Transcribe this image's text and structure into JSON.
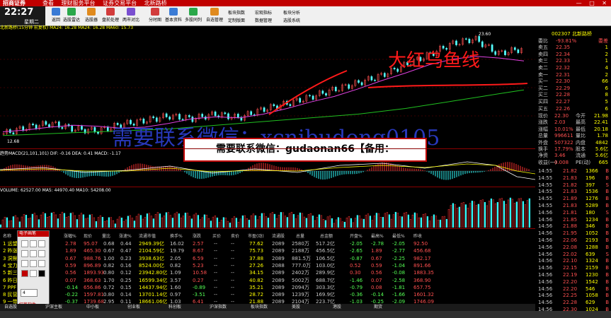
{
  "titlebar": {
    "logo": "招商证券",
    "menu": [
      "查看",
      "理财服务平台",
      "证券交易平台",
      "北新路桥"
    ],
    "win_buttons": [
      "—",
      "□",
      "✕"
    ]
  },
  "clock": {
    "time": "22:27",
    "day": "星期二"
  },
  "toolbar": {
    "items": [
      "返回",
      "选股雷达",
      "选股器",
      "盘前处理",
      "两市对比",
      "分时图",
      "基本资料",
      "多股同列",
      "自选管理"
    ],
    "menu": [
      "板块指数",
      "宏观指标",
      "板块分析",
      "定制版面",
      "数据管理",
      "选股系统"
    ]
  },
  "chart_header": "北新路桥(15分钟 前复权)  MA24: 16.28  MA24: 16.28  MA60: 15.73",
  "price_markers": {
    "high": "23.60",
    "low": "12.68"
  },
  "macd_header": "趋势MACD(21,101,101) DIF: -0.16  DEA: 0.41  MACD: -1.17",
  "volume_header": "VOLUME: 62527.00  MA5: 44970.40  MA10: 54208.00",
  "watermark": {
    "big": "需要联系微信：xcnibudong0105",
    "banner": "需要联系微信：gudaonan66【备用：xcnibudong0105】"
  },
  "annotation": "大红乌鱼线",
  "right_panel": {
    "code": "002307 北新路桥",
    "weibi": {
      "label": "委比",
      "value": "-93.81%",
      "diff": "委差"
    },
    "asks": [
      {
        "label": "卖五",
        "price": "22.35",
        "vol": "1"
      },
      {
        "label": "卖四",
        "price": "22.34",
        "vol": "2"
      },
      {
        "label": "卖三",
        "price": "22.33",
        "vol": "1"
      },
      {
        "label": "卖二",
        "price": "22.32",
        "vol": "4"
      },
      {
        "label": "卖一",
        "price": "22.31",
        "vol": "2"
      }
    ],
    "bids": [
      {
        "label": "买一",
        "price": "22.30",
        "vol": "66"
      },
      {
        "label": "买二",
        "price": "22.29",
        "vol": "6"
      },
      {
        "label": "买三",
        "price": "22.28",
        "vol": "8"
      },
      {
        "label": "买四",
        "price": "22.27",
        "vol": "5"
      },
      {
        "label": "买五",
        "price": "22.26",
        "vol": "6"
      }
    ],
    "stats": [
      {
        "l": "现价",
        "v": "22.30",
        "l2": "今开",
        "v2": "21.98"
      },
      {
        "l": "涨跌",
        "v": "2.03",
        "l2": "最高",
        "v2": "22.41"
      },
      {
        "l": "涨幅",
        "v": "10.01%",
        "l2": "最低",
        "v2": "20.18"
      },
      {
        "l": "总量",
        "v": "996611",
        "l2": "量比",
        "v2": "1.78"
      },
      {
        "l": "外盘",
        "v": "507322",
        "l2": "内盘",
        "v2": "4842"
      },
      {
        "l": "换手",
        "v": "17.79%",
        "l2": "股本",
        "v2": "5.6亿"
      },
      {
        "l": "净资",
        "v": "3.46",
        "l2": "流通",
        "v2": "5.6亿"
      },
      {
        "l": "收益(一)",
        "v": "0.008",
        "l2": "PE(动)",
        "v2": "665"
      }
    ],
    "ticks": [
      {
        "t": "14:55",
        "p": "21.82",
        "v": "1366",
        "f": "B"
      },
      {
        "t": "14:55",
        "p": "21.83",
        "v": "196",
        "f": "B"
      },
      {
        "t": "14:55",
        "p": "21.82",
        "v": "397",
        "f": "S"
      },
      {
        "t": "14:55",
        "p": "21.83",
        "v": "1536",
        "f": "B"
      },
      {
        "t": "14:55",
        "p": "21.89",
        "v": "1276",
        "f": "B"
      },
      {
        "t": "14:55",
        "p": "21.83",
        "v": "5289",
        "f": "B"
      },
      {
        "t": "14:56",
        "p": "21.81",
        "v": "180",
        "f": "S"
      },
      {
        "t": "14:56",
        "p": "21.85",
        "v": "1234",
        "f": "B"
      },
      {
        "t": "14:56",
        "p": "21.88",
        "v": "346",
        "f": "B"
      },
      {
        "t": "14:56",
        "p": "21.95",
        "v": "1052",
        "f": "B"
      },
      {
        "t": "14:56",
        "p": "22.06",
        "v": "2193",
        "f": "B"
      },
      {
        "t": "14:56",
        "p": "22.08",
        "v": "1288",
        "f": "B"
      },
      {
        "t": "14:56",
        "p": "22.02",
        "v": "639",
        "f": "S"
      },
      {
        "t": "14:56",
        "p": "22.10",
        "v": "1324",
        "f": "B"
      },
      {
        "t": "14:56",
        "p": "22.15",
        "v": "2159",
        "f": "B"
      },
      {
        "t": "14:56",
        "p": "22.19",
        "v": "1230",
        "f": "B"
      },
      {
        "t": "14:56",
        "p": "22.20",
        "v": "1542",
        "f": "B"
      },
      {
        "t": "14:56",
        "p": "22.20",
        "v": "546",
        "f": "B"
      },
      {
        "t": "14:56",
        "p": "22.25",
        "v": "1058",
        "f": "B"
      },
      {
        "t": "14:56",
        "p": "22.28",
        "v": "629",
        "f": "B"
      },
      {
        "t": "14:56",
        "p": "22.30",
        "v": "1024",
        "f": "B"
      }
    ]
  },
  "table": {
    "headers": [
      "名称",
      "涨幅%",
      "现价",
      "量比",
      "涨速%",
      "流通市值",
      "换手%",
      "涨跌",
      "买价",
      "卖价",
      "市盈(动)",
      "流通股",
      "总量",
      "总金额",
      "开盘%",
      "最高%",
      "最低%",
      "昨收"
    ],
    "rows": [
      {
        "n": "1 远望",
        "c": [
          "2.78",
          "95.07",
          "0.68",
          "0.44",
          "2949.39亿",
          "16.02",
          "2.57",
          "--",
          "--",
          "77.62",
          "2089",
          "2580万",
          "517.2亿",
          "-2.05",
          "-2.78",
          "-2.05",
          "92.50"
        ]
      },
      {
        "n": "2 昨涨",
        "c": [
          "1.89",
          "465.30",
          "0.67",
          "0.47",
          "2104.59亿",
          "19.79",
          "8.67",
          "--",
          "--",
          "75.73",
          "2089",
          "2188万",
          "456.5亿",
          "-2.65",
          "1.89",
          "-2.77",
          "456.68"
        ]
      },
      {
        "n": "3 洞察",
        "c": [
          "0.67",
          "988.76",
          "1.00",
          "0.23",
          "3938.63亿",
          "2.05",
          "6.59",
          "--",
          "--",
          "37.88",
          "2089",
          "881.5万",
          "106.5亿",
          "-0.87",
          "0.67",
          "-2.25",
          "982.17"
        ]
      },
      {
        "n": "4 宝力",
        "c": [
          "0.59",
          "896.89",
          "0.82",
          "0.16",
          "8524.00亿",
          "0.82",
          "5.23",
          "--",
          "--",
          "27.26",
          "2088",
          "777.0万",
          "103.0亿",
          "0.52",
          "0.59",
          "-1.04",
          "891.66"
        ]
      },
      {
        "n": "5 新三",
        "c": [
          "0.56",
          "1893.93",
          "0.80",
          "0.12",
          "23942.80亿",
          "1.09",
          "10.58",
          "--",
          "--",
          "34.15",
          "2089",
          "2402万",
          "289.9亿",
          "0.30",
          "0.56",
          "-0.08",
          "1883.35"
        ]
      },
      {
        "n": "6 昨日",
        "c": [
          "0.07",
          "368.63",
          "1.70",
          "0.25",
          "16599.34亿",
          "3.57",
          "0.27",
          "--",
          "--",
          "40.82",
          "2089",
          "5002万",
          "688.7亿",
          "-1.46",
          "0.07",
          "-2.58",
          "368.90"
        ]
      },
      {
        "n": "7 PPF",
        "c": [
          "-0.14",
          "656.86",
          "0.72",
          "0.15",
          "14437.94亿",
          "1.60",
          "-0.89",
          "--",
          "--",
          "35.21",
          "2089",
          "2094万",
          "303.3亿",
          "-0.79",
          "0.08",
          "-1.81",
          "657.75"
        ]
      },
      {
        "n": "8 民营",
        "c": [
          "-0.22",
          "1597.81",
          "0.80",
          "0.14",
          "13701.14亿",
          "0.97",
          "-3.51",
          "--",
          "--",
          "28.72",
          "2089",
          "1239万",
          "169.9亿",
          "-0.36",
          "-0.14",
          "-1.66",
          "1601.32"
        ]
      },
      {
        "n": "9 一带",
        "c": [
          "-0.37",
          "1739.68",
          "2.95",
          "0.11",
          "18661.06亿",
          "1.03",
          "6.41",
          "--",
          "--",
          "21.88",
          "2089",
          "2104万",
          "223.7亿",
          "-1.03",
          "-0.25",
          "-2.09",
          "1746.09"
        ]
      }
    ]
  },
  "palette": {
    "header": "电子画笔",
    "footer": "红笔软件",
    "size": "4"
  },
  "tabs": [
    "自选股",
    "沪深主板",
    "中小板",
    "创业板",
    "科创板",
    "沪深指数",
    "板块指数",
    "美股",
    "港股",
    "期货"
  ],
  "colors": {
    "up": "#ff5050",
    "down": "#54ff54",
    "bg": "#000000",
    "accent": "#c00000",
    "watermark": "#2d3fd0"
  },
  "chart_data": {
    "type": "line",
    "title": "北新路桥(15分钟 前复权)",
    "xlabel": "",
    "ylabel": "",
    "ylim": [
      12.68,
      23.6
    ],
    "series": [
      {
        "name": "MA24",
        "values": [
          13.4,
          13.6,
          13.9,
          14.1,
          14.0,
          13.8,
          13.9,
          14.3,
          14.8,
          15.0,
          14.9,
          15.3,
          15.9,
          16.6,
          17.2,
          18.0,
          18.9,
          19.7,
          20.6,
          21.2,
          21.5,
          21.3,
          21.0
        ]
      },
      {
        "name": "MA60",
        "values": [
          13.0,
          13.1,
          13.2,
          13.3,
          13.4,
          13.5,
          13.6,
          13.7,
          13.9,
          14.1,
          14.3,
          14.5,
          14.7,
          14.9,
          15.1,
          15.3,
          15.6,
          15.9,
          16.3,
          16.7,
          17.1,
          17.5,
          17.9
        ]
      }
    ],
    "candles_close": [
      13.2,
      13.9,
      14.3,
      13.7,
      13.5,
      14.2,
      14.6,
      15.1,
      14.8,
      15.3,
      14.9,
      15.8,
      16.4,
      17.1,
      17.9,
      18.6,
      19.4,
      20.5,
      21.6,
      22.8,
      23.4,
      21.8,
      22.3
    ]
  }
}
